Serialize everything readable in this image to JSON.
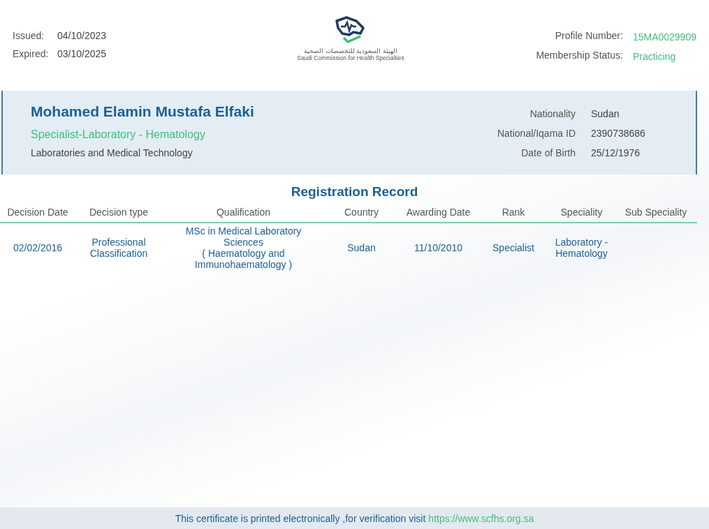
{
  "header": {
    "left": [
      {
        "label": "Issued:",
        "value": "04/10/2023"
      },
      {
        "label": "Expired:",
        "value": "03/10/2025"
      }
    ],
    "logo": {
      "arabic": "الهيئة السعودية للتخصصات الصحية",
      "english": "Saudi Commission for Health Specialties"
    },
    "right": [
      {
        "label": "Profile Number:",
        "value": "15MA0029909"
      },
      {
        "label": "Membership Status:",
        "value": "Practicing"
      }
    ]
  },
  "profile": {
    "name": "Mohamed Elamin Mustafa Elfaki",
    "title": "Specialist-Laboratory - Hematology",
    "department": "Laboratories and Medical Technology",
    "details": [
      {
        "label": "Nationality",
        "value": "Sudan"
      },
      {
        "label": "National/Iqama ID",
        "value": "2390738686"
      },
      {
        "label": "Date of Birth",
        "value": "25/12/1976"
      }
    ]
  },
  "registration": {
    "title": "Registration Record",
    "columns": [
      "Decision Date",
      "Decision type",
      "Qualification",
      "Country",
      "Awarding Date",
      "Rank",
      "Speciality",
      "Sub Speciality"
    ],
    "rows": [
      [
        "02/02/2016",
        "Professional\nClassification",
        "MSc in Medical Laboratory Sciences\n( Haematology and\nImmunohaematology )",
        "Sudan",
        "11/10/2010",
        "Specialist",
        "Laboratory -\nHematology",
        ""
      ]
    ]
  },
  "footer": {
    "text": "This certificate is printed electronically ,for verification visit",
    "link": "https://www.scfhs.org.sa"
  }
}
